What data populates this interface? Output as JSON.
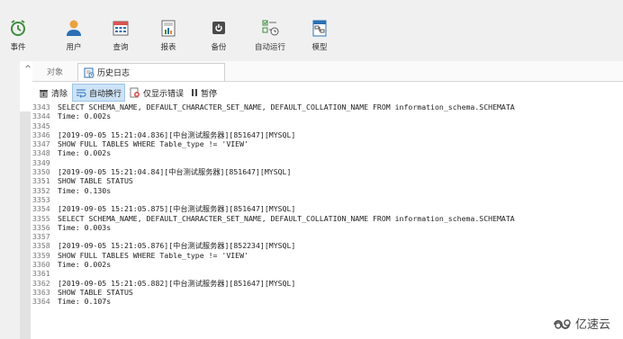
{
  "toolbar": {
    "items": [
      {
        "label": "事件",
        "icon": "alarm-clock-icon"
      },
      {
        "label": "用户",
        "icon": "user-icon"
      },
      {
        "label": "查询",
        "icon": "calendar-grid-icon"
      },
      {
        "label": "报表",
        "icon": "report-chart-icon"
      },
      {
        "label": "备份",
        "icon": "backup-disk-icon"
      },
      {
        "label": "自动运行",
        "icon": "auto-run-checklist-icon"
      },
      {
        "label": "模型",
        "icon": "model-icon"
      }
    ]
  },
  "tabs": {
    "objects": "对象",
    "history": "历史日志"
  },
  "log_toolbar": {
    "clear": "清除",
    "wrap": "自动换行",
    "errors_only": "仅显示错误",
    "pause": "暂停"
  },
  "log_lines": [
    {
      "n": "3343",
      "t": "SELECT SCHEMA_NAME, DEFAULT_CHARACTER_SET_NAME, DEFAULT_COLLATION_NAME FROM information_schema.SCHEMATA"
    },
    {
      "n": "3344",
      "t": "Time: 0.002s"
    },
    {
      "n": "3345",
      "t": ""
    },
    {
      "n": "3346",
      "t": "[2019-09-05 15:21:04.836][中台测试服务器][851647][MYSQL]"
    },
    {
      "n": "3347",
      "t": "SHOW FULL TABLES WHERE Table_type != 'VIEW'"
    },
    {
      "n": "3348",
      "t": "Time: 0.002s"
    },
    {
      "n": "3349",
      "t": ""
    },
    {
      "n": "3350",
      "t": "[2019-09-05 15:21:04.84][中台测试服务器][851647][MYSQL]"
    },
    {
      "n": "3351",
      "t": "SHOW TABLE STATUS"
    },
    {
      "n": "3352",
      "t": "Time: 0.130s"
    },
    {
      "n": "3353",
      "t": ""
    },
    {
      "n": "3354",
      "t": "[2019-09-05 15:21:05.875][中台测试服务器][851647][MYSQL]"
    },
    {
      "n": "3355",
      "t": "SELECT SCHEMA_NAME, DEFAULT_CHARACTER_SET_NAME, DEFAULT_COLLATION_NAME FROM information_schema.SCHEMATA"
    },
    {
      "n": "3356",
      "t": "Time: 0.003s"
    },
    {
      "n": "3357",
      "t": ""
    },
    {
      "n": "3358",
      "t": "[2019-09-05 15:21:05.876][中台测试服务器][852234][MYSQL]"
    },
    {
      "n": "3359",
      "t": "SHOW FULL TABLES WHERE Table_type != 'VIEW'"
    },
    {
      "n": "3360",
      "t": "Time: 0.002s"
    },
    {
      "n": "3361",
      "t": ""
    },
    {
      "n": "3362",
      "t": "[2019-09-05 15:21:05.882][中台测试服务器][851647][MYSQL]"
    },
    {
      "n": "3363",
      "t": "SHOW TABLE STATUS"
    },
    {
      "n": "3364",
      "t": "Time: 0.107s"
    }
  ],
  "watermark": "亿速云",
  "colors": {
    "toolbar_bg": "#f0f0f0",
    "active_btn_bg": "#cde3f7",
    "icon_green": "#3c8d3c",
    "icon_blue": "#2a6fb5",
    "icon_orange": "#e08a1e"
  }
}
